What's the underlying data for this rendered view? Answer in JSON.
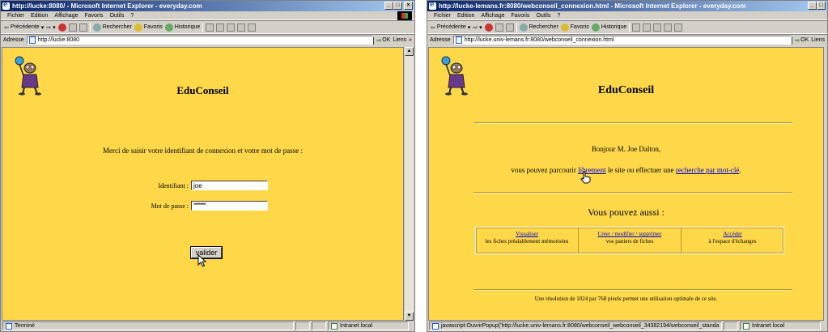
{
  "left": {
    "title": "http://lucke:8080/ - Microsoft Internet Explorer - everyday.com",
    "menu": [
      "Fichier",
      "Edition",
      "Affichage",
      "Favoris",
      "Outils",
      "?"
    ],
    "toolbar": {
      "back": "Précédente",
      "search": "Rechercher",
      "favorites": "Favoris",
      "history": "Historique"
    },
    "address": {
      "label": "Adresse",
      "url": "http://lucke:8080",
      "go": "OK",
      "links": "Liens"
    },
    "page": {
      "heading": "EduConseil",
      "prompt": "Merci de saisir votre identifiant de connexion et votre mot de passe :",
      "id_label": "Identifiant :",
      "id_value": "joe",
      "pw_label": "Mot de passe :",
      "pw_value": "***********",
      "submit": "valider"
    },
    "status": {
      "text": "Terminé",
      "zone": "Intranet local"
    }
  },
  "right": {
    "title": "http://lucke-lemans.fr:8080/webconseil_connexion.html - Microsoft Internet Explorer - everyday.com",
    "menu": [
      "Fichier",
      "Edition",
      "Affichage",
      "Favoris",
      "Outils",
      "?"
    ],
    "toolbar": {
      "back": "Précédente",
      "search": "Rechercher",
      "favorites": "Favoris",
      "history": "Historique"
    },
    "address": {
      "label": "Adresse",
      "url": "http://lucke.univ-lemans.fr:8080/webconseil_connexion.html",
      "go": "OK",
      "links": "Liens"
    },
    "page": {
      "heading": "EduConseil",
      "greeting": "Bonjour M. Joe Dalton,",
      "line_before": "vous pouvez parcourir",
      "link_browse": "librement",
      "line_middle": "le site ou effectuer une",
      "link_search": "recherche par mot-clé",
      "line_after": ".",
      "also": "Vous pouvez aussi :",
      "options": [
        {
          "link": "Visualiser",
          "text": "les fiches préalablement mémorisées"
        },
        {
          "link": "Créer / modifier / supprimer",
          "text": "vos paniers de fiches"
        },
        {
          "link": "Accéder",
          "text": "à l'espace d'échanges"
        }
      ],
      "footer": "Une résolution de 1024 par 768 pixels permet une utilisation optimale de ce site."
    },
    "status": {
      "text": "javascript:OuvrirPopup('http://lucke.univ-lemans.fr:8080/webconseil_webconseil_34382194/webconseil_standa",
      "zone": "Intranet local"
    }
  },
  "colors": {
    "page_bg": "#ffd84a",
    "titlebar": "#0a246a",
    "link": "#0000cc"
  }
}
